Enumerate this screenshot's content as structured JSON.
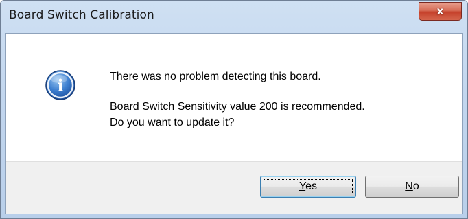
{
  "window": {
    "title": "Board Switch Calibration",
    "close_glyph": "x"
  },
  "message": {
    "line1": "There was no problem detecting this board.",
    "line2": "Board Switch Sensitivity value 200 is recommended.",
    "line3": "Do you want to update it?"
  },
  "icon": {
    "name": "info-icon",
    "glyph": "i"
  },
  "buttons": {
    "yes": {
      "mnemonic": "Y",
      "rest": "es"
    },
    "no": {
      "mnemonic": "N",
      "rest": "o"
    }
  },
  "colors": {
    "accent": "#3c7fb1",
    "close_red": "#c5412b",
    "info_blue": "#2f6fc4"
  }
}
